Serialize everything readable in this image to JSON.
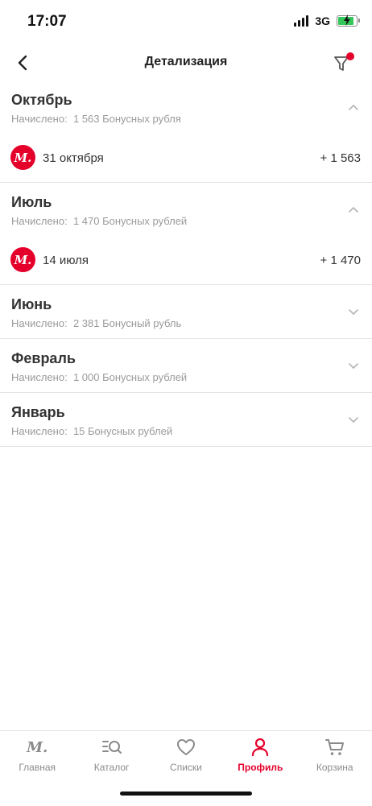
{
  "status_bar": {
    "time": "17:07",
    "network": "3G"
  },
  "header": {
    "title": "Детализация"
  },
  "months": [
    {
      "name": "Октябрь",
      "summary_label": "Начислено:",
      "summary_value": "1 563 Бонусных рубля",
      "expanded": true,
      "entries": [
        {
          "logo": "М.",
          "date": "31 октября",
          "amount": "+ 1 563"
        }
      ]
    },
    {
      "name": "Июль",
      "summary_label": "Начислено:",
      "summary_value": "1 470 Бонусных рублей",
      "expanded": true,
      "entries": [
        {
          "logo": "М.",
          "date": "14 июля",
          "amount": "+ 1 470"
        }
      ]
    },
    {
      "name": "Июнь",
      "summary_label": "Начислено:",
      "summary_value": "2 381 Бонусный рубль",
      "expanded": false,
      "entries": []
    },
    {
      "name": "Февраль",
      "summary_label": "Начислено:",
      "summary_value": "1 000 Бонусных рублей",
      "expanded": false,
      "entries": []
    },
    {
      "name": "Январь",
      "summary_label": "Начислено:",
      "summary_value": "15 Бонусных рублей",
      "expanded": false,
      "entries": []
    }
  ],
  "bottom_nav": {
    "home_logo": "М.",
    "items": [
      {
        "label": "Главная",
        "icon": "m-logo-icon",
        "active": false
      },
      {
        "label": "Каталог",
        "icon": "catalog-search-icon",
        "active": false
      },
      {
        "label": "Списки",
        "icon": "heart-icon",
        "active": false
      },
      {
        "label": "Профиль",
        "icon": "profile-icon",
        "active": true
      },
      {
        "label": "Корзина",
        "icon": "cart-icon",
        "active": false
      }
    ]
  },
  "colors": {
    "accent": "#e4002b",
    "muted_text": "#9a9a9a",
    "divider": "#e3e3e3"
  }
}
